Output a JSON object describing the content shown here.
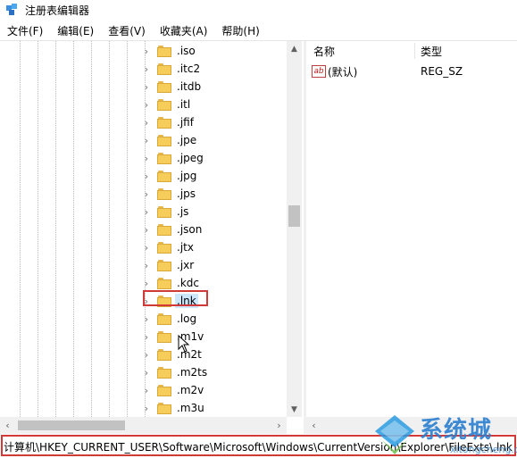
{
  "window": {
    "title": "注册表编辑器"
  },
  "menu": [
    {
      "label": "文件(F)"
    },
    {
      "label": "编辑(E)"
    },
    {
      "label": "查看(V)"
    },
    {
      "label": "收藏夹(A)"
    },
    {
      "label": "帮助(H)"
    }
  ],
  "tree": {
    "items": [
      {
        "label": ".iso"
      },
      {
        "label": ".itc2"
      },
      {
        "label": ".itdb"
      },
      {
        "label": ".itl"
      },
      {
        "label": ".jfif"
      },
      {
        "label": ".jpe"
      },
      {
        "label": ".jpeg"
      },
      {
        "label": ".jpg"
      },
      {
        "label": ".jps"
      },
      {
        "label": ".js"
      },
      {
        "label": ".json"
      },
      {
        "label": ".jtx"
      },
      {
        "label": ".jxr"
      },
      {
        "label": ".kdc"
      },
      {
        "label": ".lnk",
        "selected": true
      },
      {
        "label": ".log"
      },
      {
        "label": ".m1v"
      },
      {
        "label": ".m2t"
      },
      {
        "label": ".m2ts"
      },
      {
        "label": ".m2v"
      },
      {
        "label": ".m3u"
      }
    ]
  },
  "values_pane": {
    "columns": {
      "name": "名称",
      "type": "类型"
    },
    "rows": [
      {
        "name": "(默认)",
        "type": "REG_SZ"
      }
    ]
  },
  "status": {
    "path": "计算机\\HKEY_CURRENT_USER\\Software\\Microsoft\\Windows\\CurrentVersion\\Explorer\\FileExts\\.lnk"
  },
  "watermark": {
    "title": "系统城",
    "site": "xitongcheng.com"
  },
  "icons": {
    "folder": "folder-icon",
    "expand": "chevron-right-icon",
    "string_value": "ab-string-icon"
  },
  "colors": {
    "highlight_border": "#d23a3a",
    "selection": "#cce8ff",
    "folder": "#f6cd5b"
  }
}
